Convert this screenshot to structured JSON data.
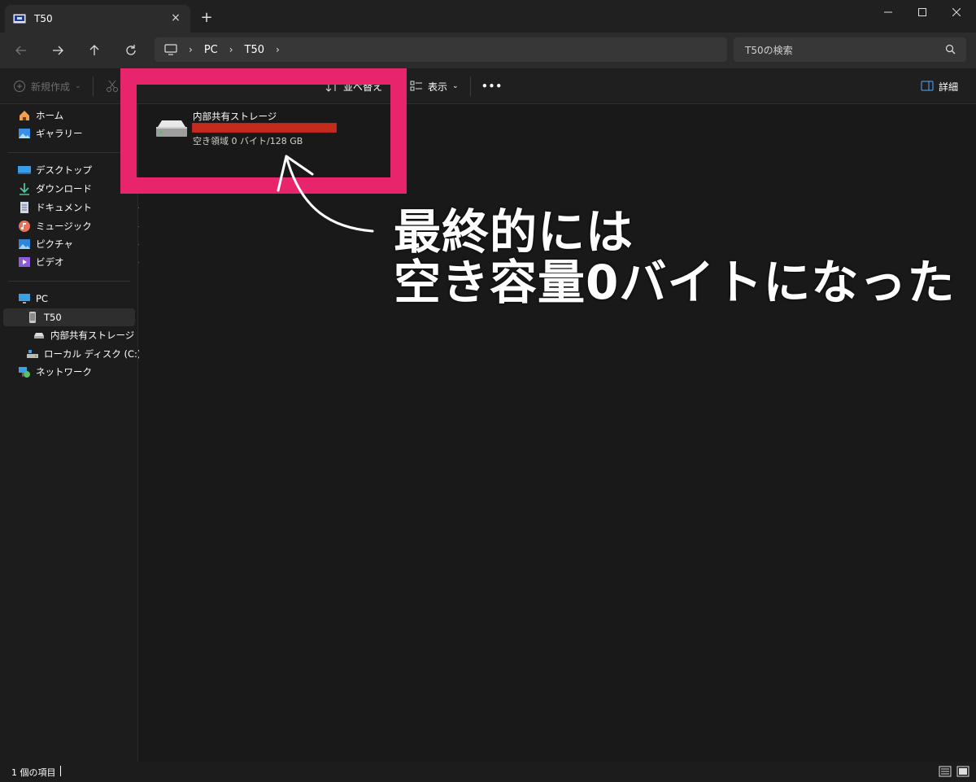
{
  "window": {
    "tab_title": "T50",
    "tab_icon": "drive-icon",
    "close_tab": "×",
    "new_tab": "+"
  },
  "nav": {
    "breadcrumb": [
      "PC",
      "T50"
    ],
    "search_placeholder": "T50の検索"
  },
  "toolbar": {
    "new_label": "新規作成",
    "sort_label": "並べ替え",
    "view_label": "表示",
    "more_label": "•••",
    "details_label": "詳細"
  },
  "sidebar": {
    "quick": [
      {
        "label": "ホーム",
        "icon": "home-icon"
      },
      {
        "label": "ギャラリー",
        "icon": "gallery-icon"
      }
    ],
    "pinned": [
      {
        "label": "デスクトップ",
        "icon": "desktop-icon"
      },
      {
        "label": "ダウンロード",
        "icon": "download-icon"
      },
      {
        "label": "ドキュメント",
        "icon": "documents-icon"
      },
      {
        "label": "ミュージック",
        "icon": "music-icon"
      },
      {
        "label": "ピクチャ",
        "icon": "pictures-icon"
      },
      {
        "label": "ビデオ",
        "icon": "videos-icon"
      }
    ],
    "tree": [
      {
        "label": "PC",
        "icon": "pc-icon"
      },
      {
        "label": "T50",
        "icon": "phone-icon",
        "selected": true
      },
      {
        "label": "内部共有ストレージ",
        "icon": "storage-icon"
      },
      {
        "label": "ローカル ディスク (C:)",
        "icon": "local-disk-icon"
      },
      {
        "label": "ネットワーク",
        "icon": "network-icon"
      }
    ]
  },
  "content": {
    "drive_name": "内部共有ストレージ",
    "drive_free": "空き領域 0 バイト/128 GB",
    "used_fraction": 1.0
  },
  "annotation": {
    "line1": "最終的には",
    "line2": "空き容量0バイトになった",
    "color": "#e8246c"
  },
  "status": {
    "item_count": "1 個の項目"
  }
}
